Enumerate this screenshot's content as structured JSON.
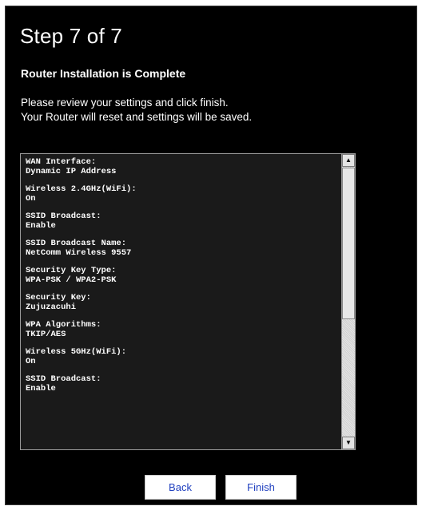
{
  "wizard": {
    "title": "Step 7 of 7",
    "subtitle": "Router Installation is Complete",
    "description_lines": [
      "Please review your settings and click finish.",
      "Your Router will reset and settings will be saved."
    ]
  },
  "settings": [
    {
      "label": "WAN Interface:",
      "value": "Dynamic IP Address"
    },
    {
      "label": "Wireless 2.4GHz(WiFi):",
      "value": "On"
    },
    {
      "label": "SSID Broadcast:",
      "value": "Enable"
    },
    {
      "label": "SSID Broadcast Name:",
      "value": "NetComm Wireless 9557"
    },
    {
      "label": "Security Key Type:",
      "value": "WPA-PSK / WPA2-PSK"
    },
    {
      "label": "Security Key:",
      "value": "Zujuzacuhi"
    },
    {
      "label": "WPA Algorithms:",
      "value": "TKIP/AES"
    },
    {
      "label": "Wireless 5GHz(WiFi):",
      "value": "On"
    },
    {
      "label": "SSID Broadcast:",
      "value": "Enable"
    }
  ],
  "scrollbar": {
    "up_icon": "arrow-up-icon",
    "down_icon": "arrow-down-icon",
    "up_glyph": "▲",
    "down_glyph": "▼"
  },
  "buttons": {
    "back_label": "Back",
    "finish_label": "Finish"
  },
  "colors": {
    "panel_background": "#000000",
    "button_text": "#1f3fbf"
  }
}
